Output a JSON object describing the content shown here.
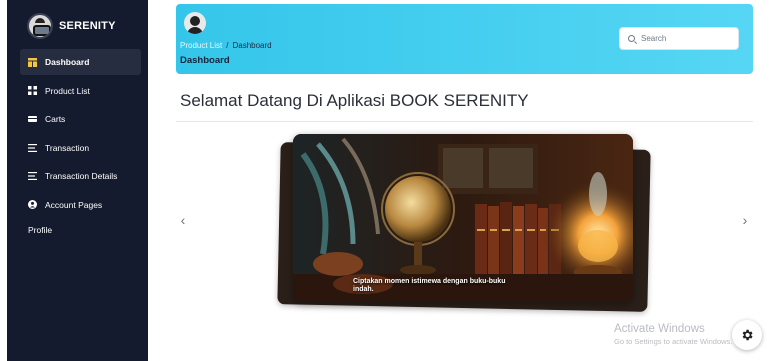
{
  "brand": {
    "name": "SERENITY"
  },
  "sidebar": {
    "items": [
      {
        "label": "Dashboard",
        "icon": "dashboard-icon",
        "active": true
      },
      {
        "label": "Product List",
        "icon": "grid-icon",
        "active": false
      },
      {
        "label": "Carts",
        "icon": "cart-icon",
        "active": false
      },
      {
        "label": "Transaction",
        "icon": "list-icon",
        "active": false
      },
      {
        "label": "Transaction Details",
        "icon": "list-icon",
        "active": false
      },
      {
        "label": "Account Pages",
        "icon": "user-icon",
        "active": false
      }
    ],
    "subitems": [
      {
        "label": "Profile"
      }
    ]
  },
  "header": {
    "breadcrumb": {
      "parent": "Product List",
      "separator": "/",
      "current": "Dashboard"
    },
    "title": "Dashboard",
    "search_placeholder": "Search"
  },
  "main": {
    "title": "Selamat Datang Di Aplikasi BOOK SERENITY",
    "carousel": {
      "caption": "Ciptakan momen istimewa dengan buku-buku indah.",
      "prev_icon": "‹",
      "next_icon": "›"
    }
  },
  "watermark": {
    "title": "Activate Windows",
    "subtitle": "Go to Settings to activate Windows."
  },
  "colors": {
    "sidebar": "#141b2e",
    "header": "#34c6ea",
    "active_item": "#262d40"
  }
}
